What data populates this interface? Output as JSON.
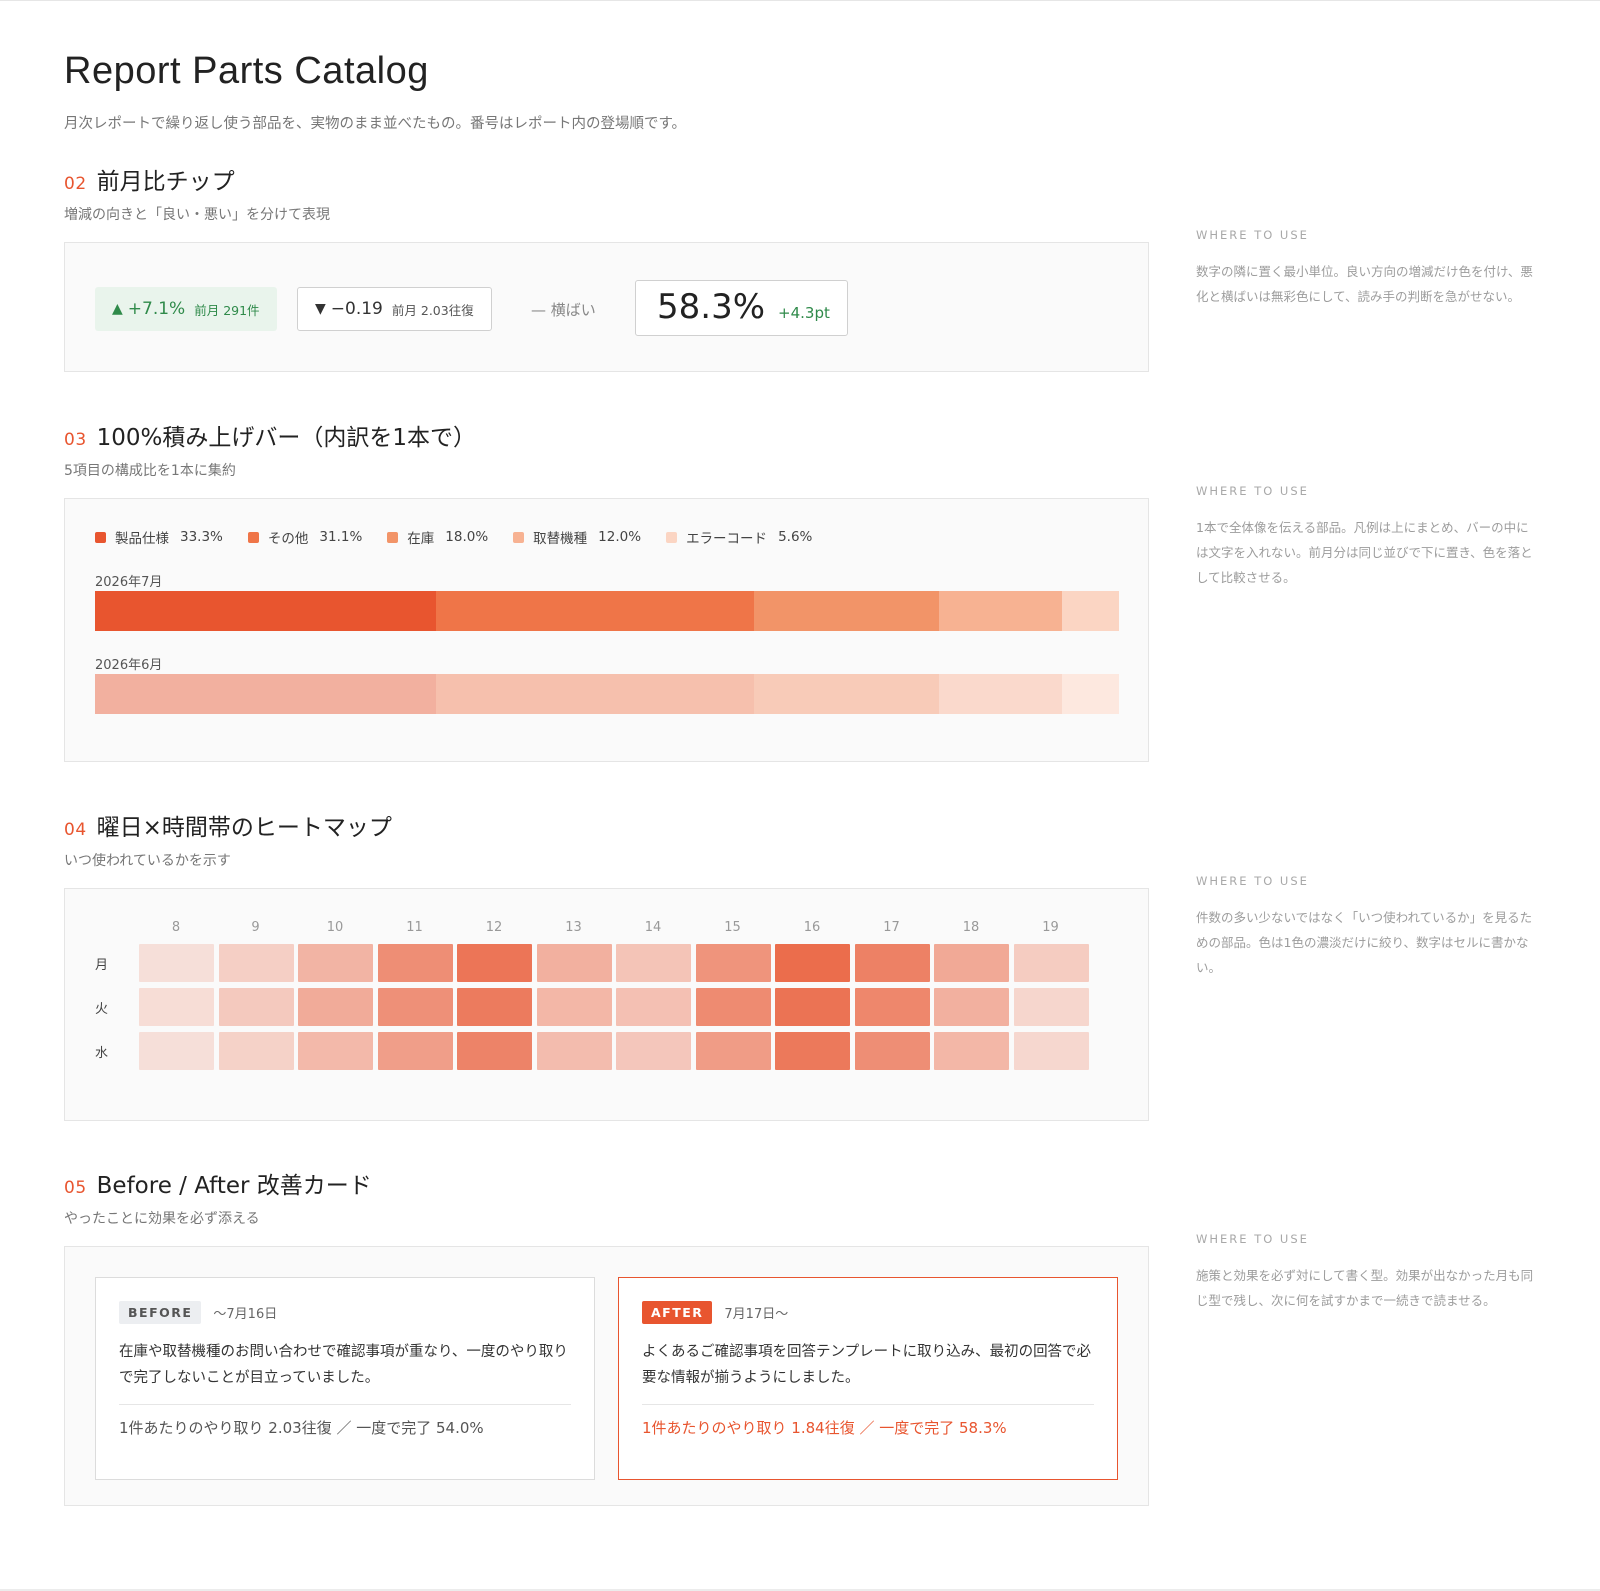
{
  "page": {
    "title": "Report Parts Catalog",
    "subtitle": "月次レポートで繰り返し使う部品を、実物のまま並べたもの。番号はレポート内の登場順です。"
  },
  "aside_label": "WHERE TO USE",
  "sections": {
    "chips": {
      "num": "02",
      "title": "前月比チップ",
      "subtitle": "増減の向きと「良い・悪い」を分けて表現",
      "up": {
        "arrow": "▲",
        "value": "+7.1%",
        "note": "前月 291件"
      },
      "down": {
        "arrow": "▼",
        "value": "−0.19",
        "note": "前月 2.03往復"
      },
      "flat": "— 横ばい",
      "big": {
        "value": "58.3%",
        "delta": "+4.3pt"
      },
      "aside": "数字の隣に置く最小単位。良い方向の増減だけ色を付け、悪化と横ばいは無彩色にして、読み手の判断を急がせない。",
      "colors": {
        "good": "#2f8a4a",
        "good_bg": "#e9f4ec"
      }
    },
    "stacked": {
      "num": "03",
      "title": "100%積み上げバー（内訳を1本で）",
      "subtitle": "5項目の構成比を1本に集約",
      "aside": "1本で全体像を伝える部品。凡例は上にまとめ、バーの中には文字を入れない。前月分は同じ並びで下に置き、色を落として比較させる。"
    },
    "heatmap": {
      "num": "04",
      "title": "曜日×時間帯のヒートマップ",
      "subtitle": "いつ使われているかを示す",
      "aside": "件数の多い少ないではなく「いつ使われているか」を見るための部品。色は1色の濃淡だけに絞り、数字はセルに書かない。"
    },
    "beforeafter": {
      "num": "05",
      "title": "Before / After 改善カード",
      "subtitle": "やったことに効果を必ず添える",
      "before": {
        "badge": "BEFORE",
        "date": "〜7月16日",
        "body": "在庫や取替機種のお問い合わせで確認事項が重なり、一度のやり取りで完了しないことが目立っていました。",
        "metric": "1件あたりのやり取り 2.03往復 ／ 一度で完了 54.0%"
      },
      "after": {
        "badge": "AFTER",
        "date": "7月17日〜",
        "body": "よくあるご確認事項を回答テンプレートに取り込み、最初の回答で必要な情報が揃うようにしました。",
        "metric": "1件あたりのやり取り 1.84往復 ／ 一度で完了 58.3%"
      },
      "aside": "施策と効果を必ず対にして書く型。効果が出なかった月も同じ型で残し、次に何を試すかまで一続きで読ませる。",
      "colors": {
        "accent": "#e8552f"
      }
    }
  },
  "chart_data": [
    {
      "type": "bar",
      "stacked": "100%",
      "orientation": "horizontal",
      "categories": [
        "2026年7月",
        "2026年6月"
      ],
      "series": [
        {
          "name": "製品仕様",
          "values": [
            33.3,
            33.3
          ],
          "color": "#e8552f",
          "prev_color": "#f2b09f",
          "pct_label": "33.3%"
        },
        {
          "name": "その他",
          "values": [
            31.1,
            31.1
          ],
          "color": "#ef7548",
          "prev_color": "#f6c0ad",
          "pct_label": "31.1%"
        },
        {
          "name": "在庫",
          "values": [
            18.0,
            18.0
          ],
          "color": "#f29468",
          "prev_color": "#f8cbb8",
          "pct_label": "18.0%"
        },
        {
          "name": "取替機種",
          "values": [
            12.0,
            12.0
          ],
          "color": "#f7b292",
          "prev_color": "#fad9cc",
          "pct_label": "12.0%"
        },
        {
          "name": "エラーコード",
          "values": [
            5.6,
            5.6
          ],
          "color": "#fbd5c3",
          "prev_color": "#fde8df",
          "pct_label": "5.6%"
        }
      ],
      "legend": "top"
    },
    {
      "type": "heatmap",
      "x": [
        "8",
        "9",
        "10",
        "11",
        "12",
        "13",
        "14",
        "15",
        "16",
        "17",
        "18",
        "19"
      ],
      "y": [
        "月",
        "火",
        "水"
      ],
      "values": [
        [
          0.1,
          0.22,
          0.42,
          0.7,
          0.88,
          0.45,
          0.3,
          0.66,
          0.95,
          0.8,
          0.5,
          0.24
        ],
        [
          0.12,
          0.26,
          0.48,
          0.68,
          0.84,
          0.4,
          0.33,
          0.73,
          0.9,
          0.76,
          0.45,
          0.17
        ],
        [
          0.1,
          0.2,
          0.38,
          0.58,
          0.78,
          0.36,
          0.28,
          0.6,
          0.86,
          0.7,
          0.4,
          0.16
        ]
      ],
      "color": "#e8552f"
    }
  ]
}
